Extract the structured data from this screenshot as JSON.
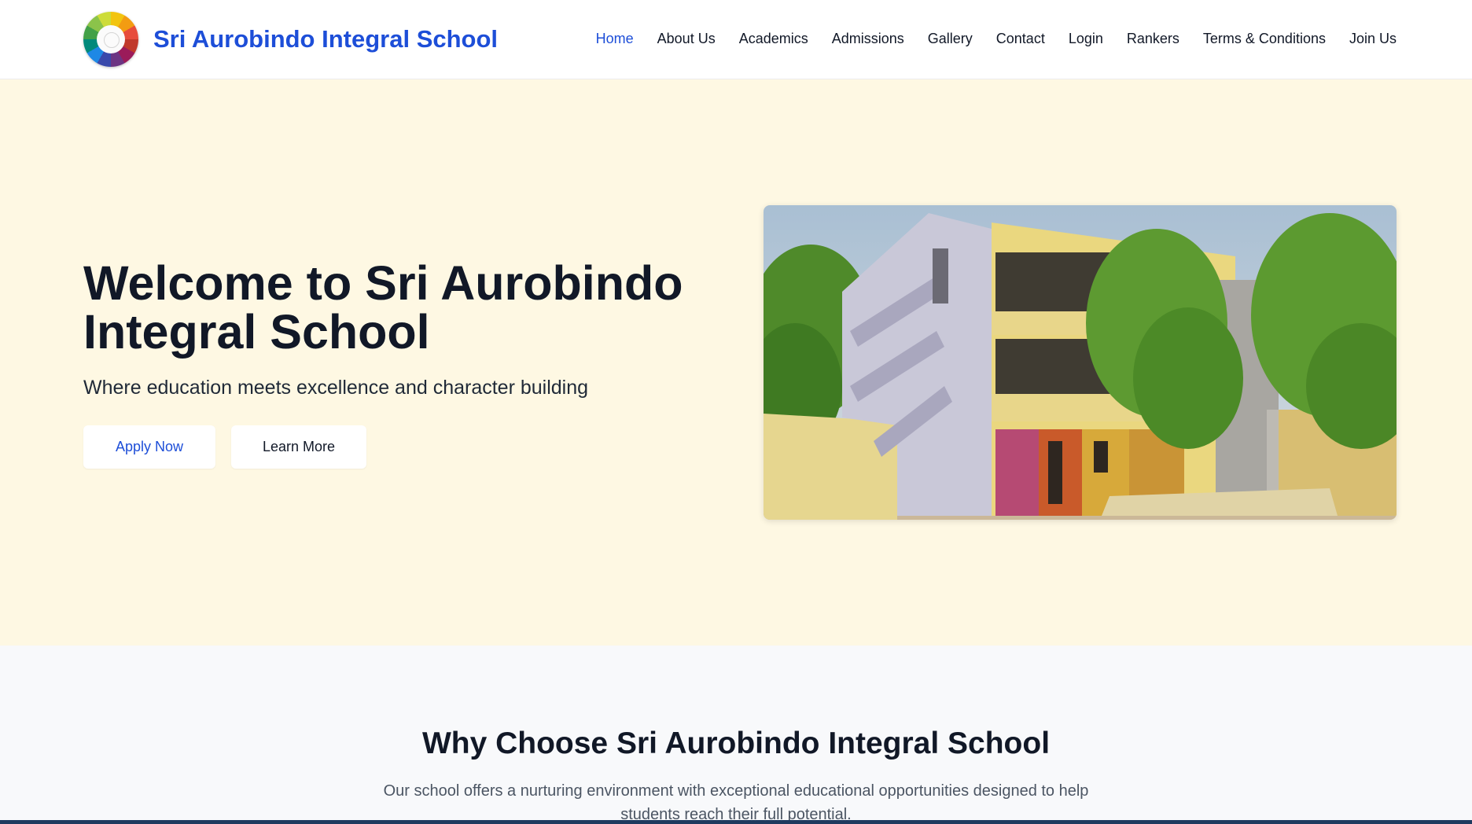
{
  "header": {
    "brand": "Sri Aurobindo Integral School",
    "logo_icon": "color-wheel-logo-icon",
    "nav": [
      {
        "label": "Home",
        "active": true
      },
      {
        "label": "About Us"
      },
      {
        "label": "Academics"
      },
      {
        "label": "Admissions"
      },
      {
        "label": "Gallery"
      },
      {
        "label": "Contact"
      },
      {
        "label": "Login"
      },
      {
        "label": "Rankers"
      },
      {
        "label": "Terms & Conditions"
      },
      {
        "label": "Join Us"
      }
    ]
  },
  "hero": {
    "title": "Welcome to Sri Aurobindo Integral School",
    "subtitle": "Where education meets excellence and character building",
    "apply_label": "Apply Now",
    "learn_label": "Learn More"
  },
  "why": {
    "title": "Why Choose Sri Aurobindo Integral School",
    "text": "Our school offers a nurturing environment with exceptional educational opportunities designed to help students reach their full potential."
  },
  "colors": {
    "accent": "#1d4ed8",
    "hero_bg": "#fef8e3",
    "section_bg": "#f8f9fb",
    "heading": "#111827"
  }
}
